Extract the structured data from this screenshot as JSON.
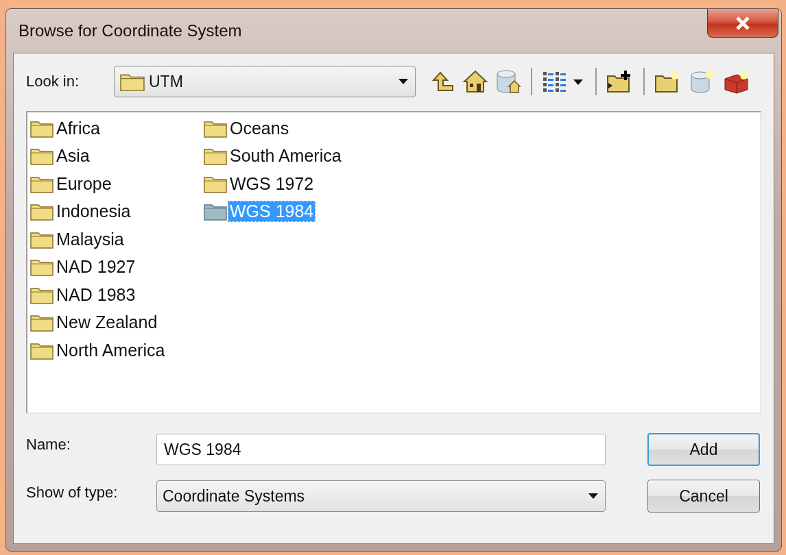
{
  "window": {
    "title": "Browse for Coordinate System"
  },
  "look_in": {
    "label": "Look in:",
    "value": "UTM"
  },
  "items": [
    {
      "name": "Africa",
      "selected": false
    },
    {
      "name": "Asia",
      "selected": false
    },
    {
      "name": "Europe",
      "selected": false
    },
    {
      "name": "Indonesia",
      "selected": false
    },
    {
      "name": "Malaysia",
      "selected": false
    },
    {
      "name": "NAD 1927",
      "selected": false
    },
    {
      "name": "NAD 1983",
      "selected": false
    },
    {
      "name": "New Zealand",
      "selected": false
    },
    {
      "name": "North America",
      "selected": false
    },
    {
      "name": "Oceans",
      "selected": false
    },
    {
      "name": "South America",
      "selected": false
    },
    {
      "name": "WGS 1972",
      "selected": false
    },
    {
      "name": "WGS 1984",
      "selected": true
    }
  ],
  "name_field": {
    "label": "Name:",
    "value": "WGS 1984"
  },
  "type_field": {
    "label": "Show of type:",
    "value": "Coordinate Systems"
  },
  "buttons": [
    {
      "label": "Add",
      "default": true
    },
    {
      "label": "Cancel",
      "default": false
    }
  ]
}
